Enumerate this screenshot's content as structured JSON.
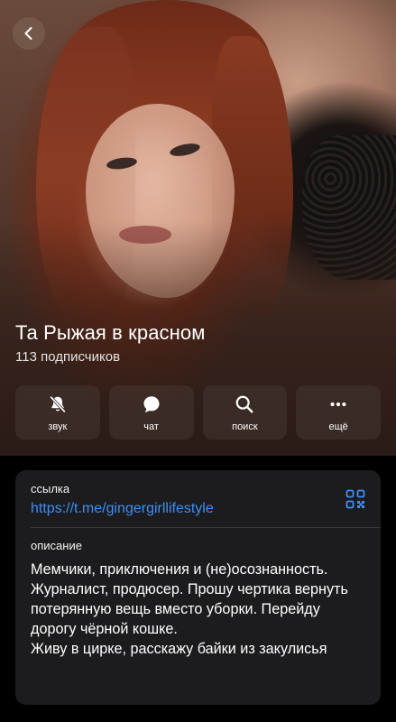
{
  "header": {
    "back_icon": "chevron-left-icon"
  },
  "profile": {
    "name": "Та Рыжая в красном",
    "subscribers": "113 подписчиков"
  },
  "actions": [
    {
      "label": "звук",
      "icon": "bell-slash-icon"
    },
    {
      "label": "чат",
      "icon": "chat-bubble-icon"
    },
    {
      "label": "поиск",
      "icon": "search-icon"
    },
    {
      "label": "ещё",
      "icon": "more-dots-icon"
    }
  ],
  "info": {
    "link_label": "ссылка",
    "link_value": "https://t.me/gingergirllifestyle",
    "qr_icon": "qr-code-icon",
    "description_label": "описание",
    "description_text": "Мемчики, приключения и (не)осознанность. Журналист, продюсер. Прошу чертика вернуть потерянную вещь вместо уборки. Перейду дорогу чёрной кошке.\nЖиву в цирке, расскажу байки из закулисья"
  },
  "colors": {
    "accent_link": "#3e8ef7",
    "card_bg": "#1c1c1e",
    "page_bg": "#000000"
  }
}
